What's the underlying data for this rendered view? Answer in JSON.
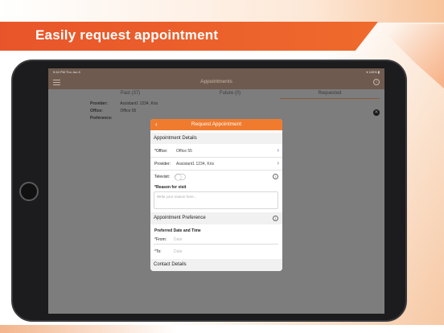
{
  "banner": {
    "title": "Easily request appointment"
  },
  "status_bar": {
    "time": "9:44 PM  Thu Jun 8",
    "battery": "▾ 100% ▮"
  },
  "nav": {
    "title": "Appointments",
    "info": "i"
  },
  "tabs": [
    {
      "label": "Past (37)"
    },
    {
      "label": "Future (0)"
    },
    {
      "label": "Requested"
    }
  ],
  "record": {
    "provider_label": "Provider:",
    "provider_value": "Assistant1 1234, Kris",
    "office_label": "Office:",
    "office_value": "Office 55",
    "preference_label": "Preference:",
    "close": "✕"
  },
  "modal": {
    "title": "Request Appointment",
    "back": "‹",
    "details_head": "Appointment Details",
    "office_label": "*Office:",
    "office_value": "Office 55",
    "provider_label": "Provider:",
    "provider_value": "Assistant1 1234, Kris",
    "televisit_label": "Televisit:",
    "reason_label": "*Reason for visit",
    "reason_placeholder": "Write your reason here...",
    "preference_head": "Appointment Preference",
    "preferred_label": "Preferred Date and Time",
    "from_label": "*From:",
    "from_placeholder": "Date",
    "to_label": "*To:",
    "to_placeholder": "Date",
    "contact_head": "Contact Details",
    "chevron": "›",
    "info": "i"
  },
  "colors": {
    "accent": "#f07b2e",
    "banner": "#e8552a",
    "nav": "#6e5a4e"
  }
}
